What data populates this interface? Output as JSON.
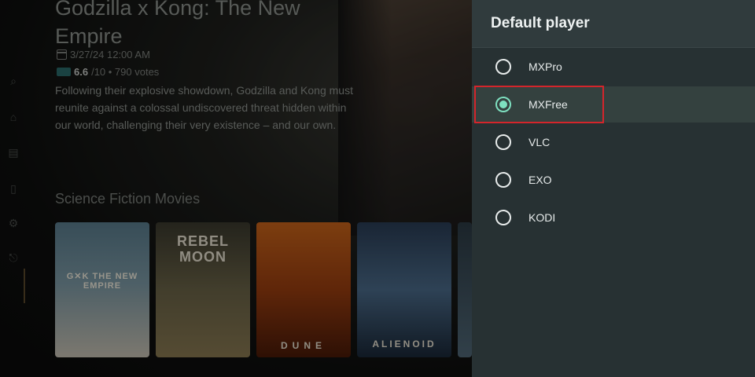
{
  "movie": {
    "title": "Godzilla x Kong: The New Empire",
    "date": "3/27/24 12:00 AM",
    "rating": "6.6",
    "rating_suffix": "/10 • 790 votes",
    "description": "Following their explosive showdown, Godzilla and Kong must reunite against a colossal undiscovered threat hidden within our world, challenging their very existence – and our own."
  },
  "row": {
    "title": "Science Fiction Movies",
    "posters": [
      {
        "text": "G✕K THE NEW EMPIRE"
      },
      {
        "text": "REBEL MOON"
      },
      {
        "text": "DUNE"
      },
      {
        "text": "ALIENOID"
      },
      {
        "text": ""
      }
    ]
  },
  "sidebar": {
    "icons": [
      "search-icon",
      "home-icon",
      "list-icon",
      "bookmark-icon",
      "gear-icon",
      "exit-icon"
    ]
  },
  "dialog": {
    "title": "Default player",
    "options": [
      {
        "label": "MXPro",
        "selected": false
      },
      {
        "label": "MXFree",
        "selected": true
      },
      {
        "label": "VLC",
        "selected": false
      },
      {
        "label": "EXO",
        "selected": false
      },
      {
        "label": "KODI",
        "selected": false
      }
    ],
    "accent_color": "#7ee0c0",
    "highlight_color": "#d4252b"
  }
}
